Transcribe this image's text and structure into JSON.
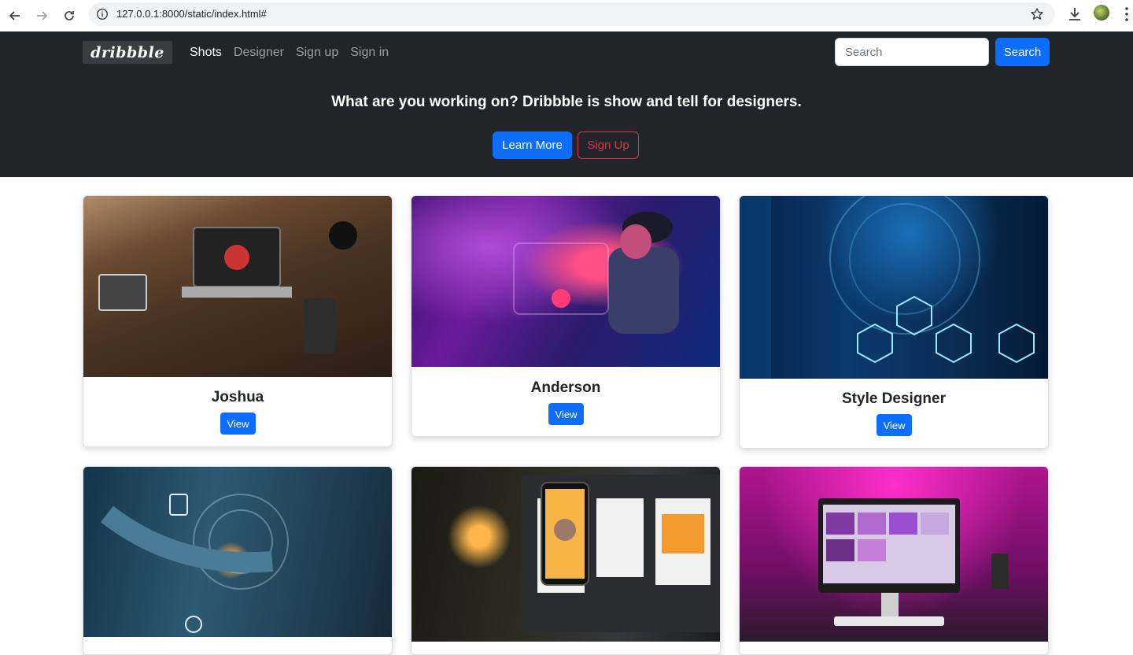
{
  "browser": {
    "url": "127.0.0.1:8000/static/index.html#"
  },
  "navbar": {
    "brand": "dribbble",
    "links": [
      "Shots",
      "Designer",
      "Sign up",
      "Sign in"
    ],
    "search_placeholder": "Search",
    "search_button": "Search"
  },
  "hero": {
    "tagline": "What are you working on? Dribbble is show and tell for designers.",
    "primary_button": "Learn More",
    "secondary_button": "Sign Up"
  },
  "cards": [
    {
      "title": "Joshua",
      "button": "View",
      "image": "desk-workspace-photo"
    },
    {
      "title": "Anderson",
      "button": "View",
      "image": "vr-headset-photo"
    },
    {
      "title": "Style Designer",
      "button": "View",
      "image": "digital-globe-photo"
    },
    {
      "title": "",
      "button": "",
      "image": "fingerprint-tech-photo"
    },
    {
      "title": "",
      "button": "",
      "image": "phone-design-photo"
    },
    {
      "title": "",
      "button": "",
      "image": "pink-desk-setup-photo"
    }
  ],
  "colors": {
    "navbar_bg": "#212529",
    "primary": "#0d6efd",
    "danger": "#dc3545"
  }
}
